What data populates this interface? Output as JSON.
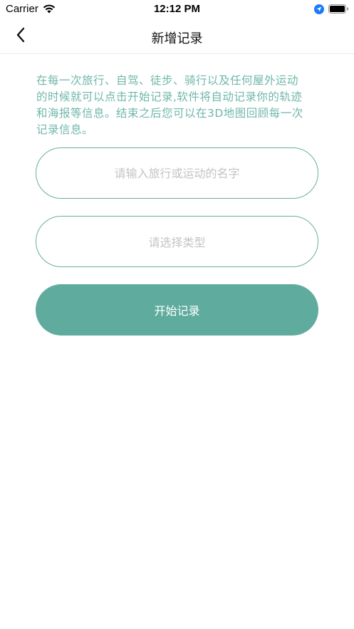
{
  "status_bar": {
    "carrier": "Carrier",
    "time": "12:12 PM",
    "icons": [
      "wifi-icon",
      "location-icon",
      "battery-icon"
    ]
  },
  "nav": {
    "title": "新增记录",
    "back_icon": "chevron-left-icon"
  },
  "description": {
    "lines": [
      "在每一次旅行、自驾、徒步、骑行以及任何屋外运动",
      "的时候就可以点击开始记录,软件将自动记录你的轨迹",
      "和海报等信息。结束之后您可以在3D地图回顾每一次",
      "记录信息。"
    ]
  },
  "form": {
    "name_placeholder": "请输入旅行或运动的名字",
    "name_value": "",
    "type_placeholder": "请选择类型",
    "start_label": "开始记录"
  },
  "colors": {
    "accent": "#5fac9e",
    "description_text": "#6fb7a9",
    "field_border": "#6aada1",
    "placeholder": "#c4c4c4"
  }
}
